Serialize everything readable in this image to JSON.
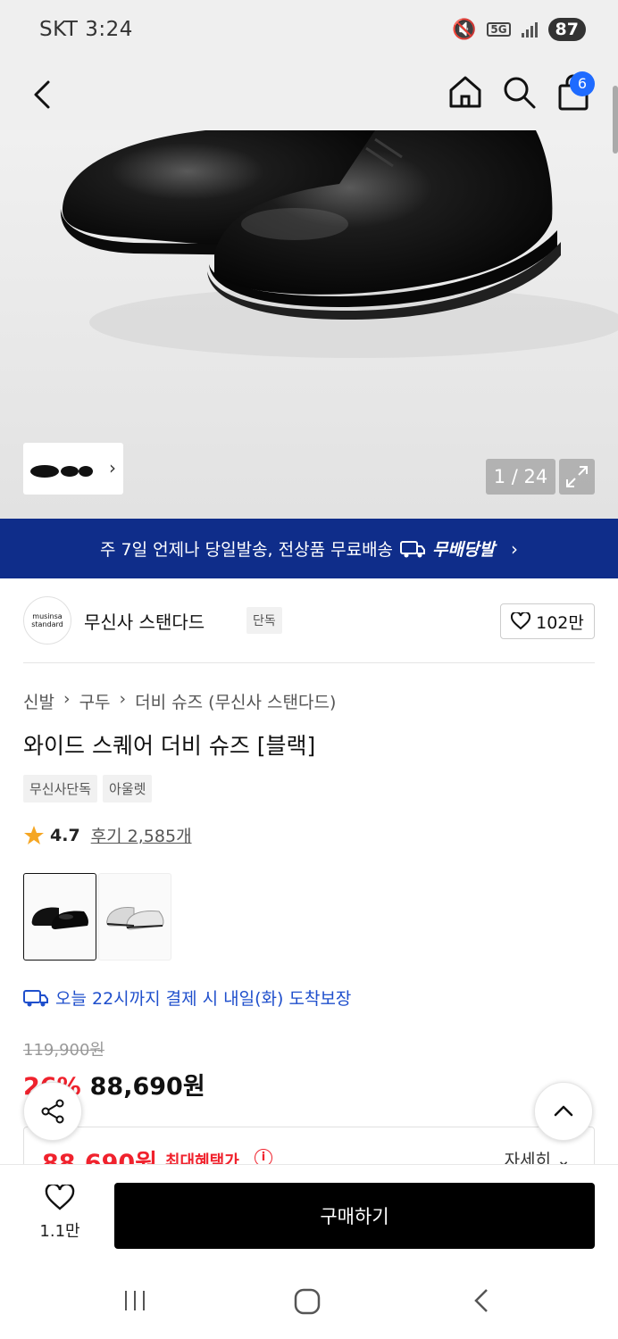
{
  "status_bar": {
    "carrier_time": "SKT 3:24",
    "network": "5G",
    "battery": "87"
  },
  "header": {
    "cart_count": "6"
  },
  "gallery": {
    "counter": "1 / 24"
  },
  "banner": {
    "text": "주 7일 언제나 당일발송, 전상품 무료배송",
    "badge": "무배당발"
  },
  "brand": {
    "logo_line1": "musinsa",
    "logo_line2": "standard",
    "name": "무신사 스탠다드",
    "tag": "단독",
    "likes": "102만"
  },
  "breadcrumb": [
    "신발",
    "구두",
    "더비 슈즈 (무신사 스탠다드)"
  ],
  "product": {
    "title": "와이드 스퀘어 더비 슈즈 [블랙]",
    "tags": [
      "무신사단독",
      "아울렛"
    ],
    "rating": "4.7",
    "reviews": "후기 2,585개",
    "delivery": "오늘 22시까지 결제 시 내일(화) 도착보장",
    "original_price": "119,900원",
    "discount": "26%",
    "price": "88,690원"
  },
  "benefit": {
    "price": "88,690원",
    "label": "최대혜택가",
    "info": "i",
    "detail": "자세히"
  },
  "bottom": {
    "wish_count": "1.1만",
    "buy_label": "구매하기"
  },
  "colors": {
    "banner": "#0f2d8a",
    "discount": "#f0222d",
    "delivery": "#1f4fcc",
    "badge": "#1f6bff"
  }
}
